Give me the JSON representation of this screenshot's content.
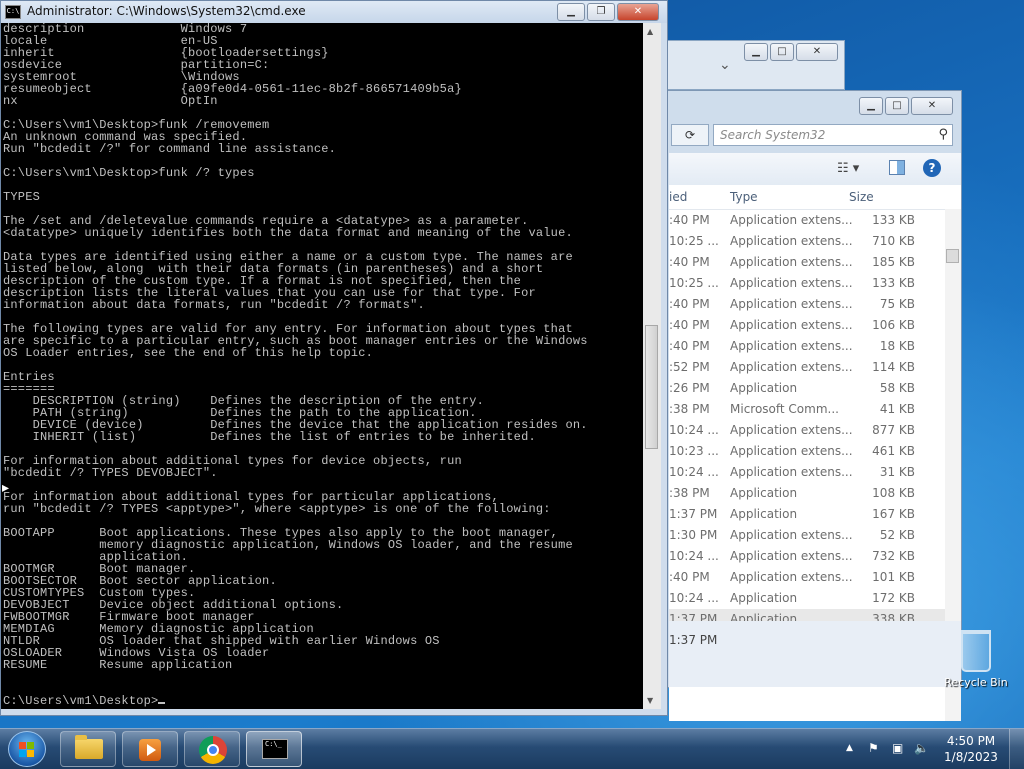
{
  "colors": {
    "desktop": "#1a6fb5",
    "console_bg": "#000000",
    "console_fg": "#c0c0c0",
    "taskbar": "#274b74"
  },
  "cmd_window": {
    "title": "Administrator: C:\\Windows\\System32\\cmd.exe",
    "icon": "cmd-icon",
    "lines": [
      "description             Windows 7",
      "locale                  en-US",
      "inherit                 {bootloadersettings}",
      "osdevice                partition=C:",
      "systemroot              \\Windows",
      "resumeobject            {a09fe0d4-0561-11ec-8b2f-866571409b5a}",
      "nx                      OptIn",
      "",
      "C:\\Users\\vm1\\Desktop>funk /removemem",
      "An unknown command was specified.",
      "Run \"bcdedit /?\" for command line assistance.",
      "",
      "C:\\Users\\vm1\\Desktop>funk /? types",
      "",
      "TYPES",
      "",
      "The /set and /deletevalue commands require a <datatype> as a parameter.",
      "<datatype> uniquely identifies both the data format and meaning of the value.",
      "",
      "Data types are identified using either a name or a custom type. The names are",
      "listed below, along  with their data formats (in parentheses) and a short",
      "description of the custom type. If a format is not specified, then the",
      "description lists the literal values that you can use for that type. For",
      "information about data formats, run \"bcdedit /? formats\".",
      "",
      "The following types are valid for any entry. For information about types that",
      "are specific to a particular entry, such as boot manager entries or the Windows",
      "OS Loader entries, see the end of this help topic.",
      "",
      "Entries",
      "=======",
      "    DESCRIPTION (string)    Defines the description of the entry.",
      "    PATH (string)           Defines the path to the application.",
      "    DEVICE (device)         Defines the device that the application resides on.",
      "    INHERIT (list)          Defines the list of entries to be inherited.",
      "",
      "For information about additional types for device objects, run",
      "\"bcdedit /? TYPES DEVOBJECT\".",
      "",
      "For information about additional types for particular applications,",
      "run \"bcdedit /? TYPES <apptype>\", where <apptype> is one of the following:",
      "",
      "BOOTAPP      Boot applications. These types also apply to the boot manager,",
      "             memory diagnostic application, Windows OS loader, and the resume",
      "             application.",
      "BOOTMGR      Boot manager.",
      "BOOTSECTOR   Boot sector application.",
      "CUSTOMTYPES  Custom types.",
      "DEVOBJECT    Device object additional options.",
      "FWBOOTMGR    Firmware boot manager",
      "MEMDIAG      Memory diagnostic application",
      "NTLDR        OS loader that shipped with earlier Windows OS",
      "OSLOADER     Windows Vista OS loader",
      "RESUME       Resume application",
      "",
      "",
      "C:\\Users\\vm1\\Desktop>"
    ]
  },
  "explorer": {
    "search_placeholder": "Search System32",
    "columns": {
      "date": "ied",
      "type": "Type",
      "size": "Size"
    },
    "files": [
      {
        "date": ":40 PM",
        "type": "Application extens...",
        "size": "133 KB"
      },
      {
        "date": "10:25 ...",
        "type": "Application extens...",
        "size": "710 KB"
      },
      {
        "date": ":40 PM",
        "type": "Application extens...",
        "size": "185 KB"
      },
      {
        "date": "10:25 ...",
        "type": "Application extens...",
        "size": "133 KB"
      },
      {
        "date": ":40 PM",
        "type": "Application extens...",
        "size": "75 KB"
      },
      {
        "date": ":40 PM",
        "type": "Application extens...",
        "size": "106 KB"
      },
      {
        "date": ":40 PM",
        "type": "Application extens...",
        "size": "18 KB"
      },
      {
        "date": ":52 PM",
        "type": "Application extens...",
        "size": "114 KB"
      },
      {
        "date": ":26 PM",
        "type": "Application",
        "size": "58 KB"
      },
      {
        "date": ":38 PM",
        "type": "Microsoft Comm...",
        "size": "41 KB"
      },
      {
        "date": "10:24 ...",
        "type": "Application extens...",
        "size": "877 KB"
      },
      {
        "date": "10:23 ...",
        "type": "Application extens...",
        "size": "461 KB"
      },
      {
        "date": "10:24 ...",
        "type": "Application extens...",
        "size": "31 KB"
      },
      {
        "date": ":38 PM",
        "type": "Application",
        "size": "108 KB"
      },
      {
        "date": "1:37 PM",
        "type": "Application",
        "size": "167 KB"
      },
      {
        "date": "1:30 PM",
        "type": "Application extens...",
        "size": "52 KB"
      },
      {
        "date": "10:24 ...",
        "type": "Application extens...",
        "size": "732 KB"
      },
      {
        "date": ":40 PM",
        "type": "Application extens...",
        "size": "101 KB"
      },
      {
        "date": "10:24 ...",
        "type": "Application",
        "size": "172 KB"
      },
      {
        "date": "1:37 PM",
        "type": "Application",
        "size": "338 KB"
      }
    ],
    "details_time": "1:37 PM"
  },
  "desktop_icons": {
    "recycle_bin": "Recycle Bin"
  },
  "taskbar": {
    "apps": [
      "explorer-folder-icon",
      "media-player-icon",
      "chrome-icon",
      "cmd-icon"
    ],
    "clock_time": "4:50 PM",
    "clock_date": "1/8/2023"
  }
}
